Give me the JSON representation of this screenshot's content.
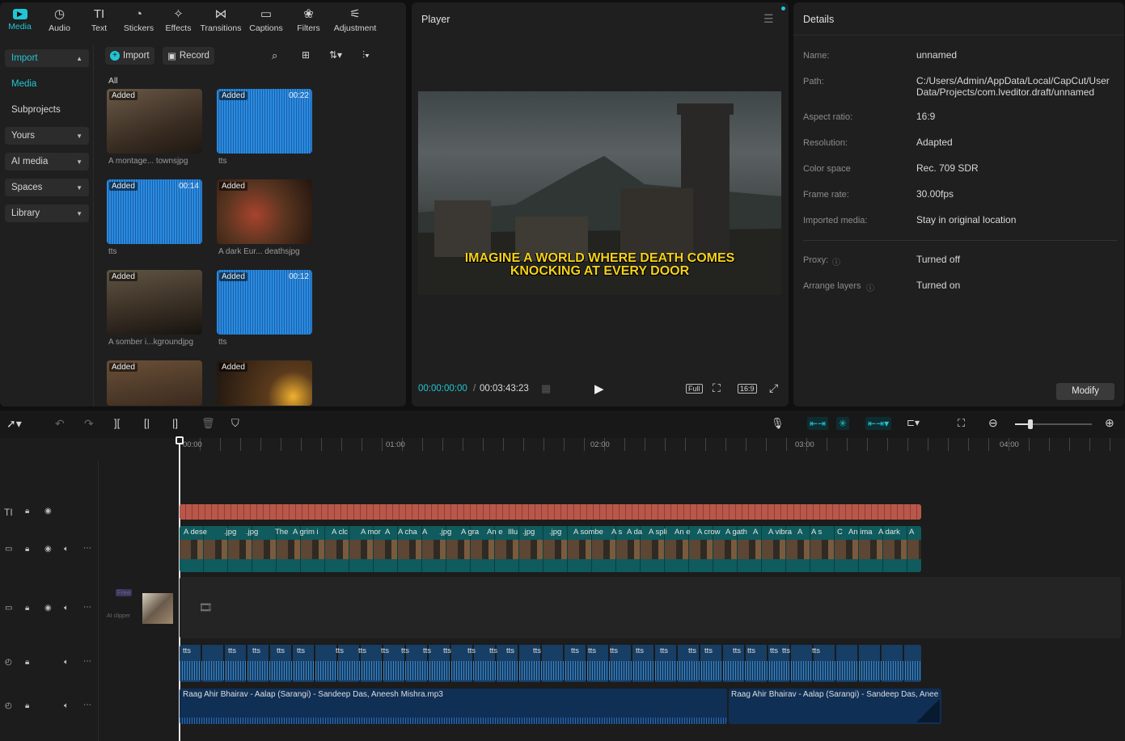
{
  "toolbar": {
    "tabs": [
      {
        "label": "Media",
        "icon": "media-icon"
      },
      {
        "label": "Audio",
        "icon": "audio-icon"
      },
      {
        "label": "Text",
        "icon": "text-icon"
      },
      {
        "label": "Stickers",
        "icon": "stickers-icon"
      },
      {
        "label": "Effects",
        "icon": "effects-icon"
      },
      {
        "label": "Transitions",
        "icon": "transitions-icon"
      },
      {
        "label": "Captions",
        "icon": "captions-icon"
      },
      {
        "label": "Filters",
        "icon": "filters-icon"
      },
      {
        "label": "Adjustment",
        "icon": "adjustment-icon"
      }
    ]
  },
  "nav": {
    "import": "Import",
    "media": "Media",
    "subprojects": "Subprojects",
    "yours": "Yours",
    "ai_media": "AI media",
    "spaces": "Spaces",
    "library": "Library"
  },
  "media": {
    "import_btn": "Import",
    "record_btn": "Record",
    "filter_all": "All",
    "added": "Added",
    "items": [
      {
        "caption": "A montage... townsjpg",
        "duration": ""
      },
      {
        "caption": "tts",
        "duration": "00:22"
      },
      {
        "caption": "tts",
        "duration": "00:14"
      },
      {
        "caption": "A dark Eur... deathsjpg",
        "duration": ""
      },
      {
        "caption": "A somber i...kgroundjpg",
        "duration": ""
      },
      {
        "caption": "tts",
        "duration": "00:12"
      },
      {
        "caption": "",
        "duration": ""
      },
      {
        "caption": "",
        "duration": ""
      }
    ]
  },
  "player": {
    "title": "Player",
    "overlay_line1": "IMAGINE A WORLD WHERE DEATH COMES",
    "overlay_line2": "KNOCKING AT EVERY DOOR",
    "current_time": "00:00:00:00",
    "total_time": "00:03:43:23",
    "full": "Full",
    "ratio": "16:9"
  },
  "details": {
    "title": "Details",
    "rows": [
      {
        "label": "Name:",
        "value": "unnamed"
      },
      {
        "label": "Path:",
        "value": "C:/Users/Admin/AppData/Local/CapCut/User Data/Projects/com.lveditor.draft/unnamed"
      },
      {
        "label": "Aspect ratio:",
        "value": "16:9"
      },
      {
        "label": "Resolution:",
        "value": "Adapted"
      },
      {
        "label": "Color space",
        "value": "Rec. 709 SDR"
      },
      {
        "label": "Frame rate:",
        "value": "30.00fps"
      },
      {
        "label": "Imported media:",
        "value": "Stay in original location"
      },
      {
        "label": "Proxy:",
        "value": "Turned off"
      },
      {
        "label": "Arrange layers",
        "value": "Turned on"
      }
    ],
    "modify": "Modify"
  },
  "timeline": {
    "ruler": [
      "00:00",
      "01:00",
      "02:00",
      "03:00",
      "04:00"
    ],
    "video_labels": [
      "A dese",
      ".jpg",
      ".jpg",
      "The",
      "A grim i",
      "A clc",
      "A mor",
      "A",
      "A cha",
      "A",
      ".jpg",
      "A gra",
      "An e",
      "Illu",
      ".jpg",
      ".jpg",
      "A sombe",
      "A s",
      "A da",
      "A spli",
      "An e",
      "A crow",
      "A gath",
      "A",
      "A vibra",
      "A",
      "A s",
      "C",
      "An ima",
      "A dark",
      "A"
    ],
    "tts_label": "tts",
    "free": "Free",
    "ai_clipper": "AI clipper",
    "music1": "Raag Ahir Bhairav - Aalap (Sarangi) - Sandeep Das,  Aneesh Mishra.mp3",
    "music2": "Raag Ahir Bhairav - Aalap (Sarangi) - Sandeep Das,  Anee"
  }
}
